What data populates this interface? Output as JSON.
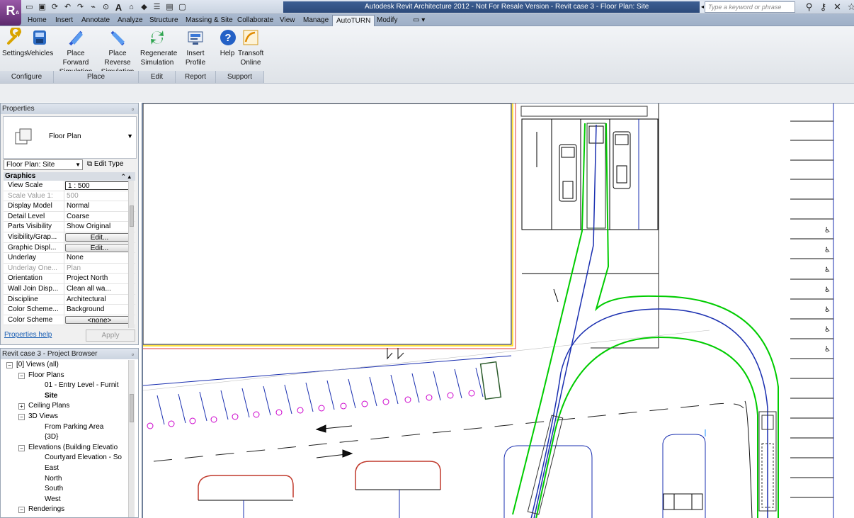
{
  "titlebar": {
    "app_letter": "R",
    "app_sub": "A",
    "title": "Autodesk Revit Architecture 2012 - Not For Resale Version -     Revit case 3 - Floor Plan: Site",
    "search_placeholder": "Type a keyword or phrase",
    "qat_icons": [
      "open-icon",
      "save-icon",
      "sync-icon",
      "undo-icon",
      "redo-icon",
      "measure-icon",
      "text-icon",
      "3d-view-icon",
      "section-icon",
      "thin-lines-icon",
      "close-windows-icon"
    ],
    "right_icons": [
      "binoculars-icon",
      "key-icon",
      "close-icon",
      "star-icon"
    ]
  },
  "tabs": [
    "Home",
    "Insert",
    "Annotate",
    "Analyze",
    "Structure",
    "Massing & Site",
    "Collaborate",
    "View",
    "Manage",
    "AutoTURN",
    "Modify"
  ],
  "active_tab": "AutoTURN",
  "ribbon": {
    "buttons": [
      {
        "label1": "Settings",
        "label2": "",
        "icon": "wrench-icon"
      },
      {
        "label1": "Vehicles",
        "label2": "",
        "icon": "vehicles-icon"
      },
      {
        "label1": "Place Forward",
        "label2": "Simulation",
        "icon": "place-forward-icon"
      },
      {
        "label1": "Place Reverse",
        "label2": "Simulation",
        "icon": "place-reverse-icon"
      },
      {
        "label1": "Regenerate",
        "label2": "Simulation",
        "icon": "regenerate-icon"
      },
      {
        "label1": "Insert Profile",
        "label2": "",
        "icon": "insert-profile-icon"
      },
      {
        "label1": "Help",
        "label2": "",
        "icon": "help-icon"
      },
      {
        "label1": "Transoft",
        "label2": "Online",
        "icon": "transoft-icon"
      }
    ],
    "panels": [
      "Configure",
      "Place",
      "Edit",
      "Report",
      "Support"
    ]
  },
  "properties": {
    "title": "Properties",
    "type_name": "Floor Plan",
    "instance_selector": "Floor Plan: Site",
    "edit_type": "Edit Type",
    "group": "Graphics",
    "rows": [
      {
        "name": "View Scale",
        "value": "1 : 500",
        "kind": "box"
      },
      {
        "name": "Scale Value   1:",
        "value": "500",
        "kind": "dim"
      },
      {
        "name": "Display Model",
        "value": "Normal",
        "kind": ""
      },
      {
        "name": "Detail Level",
        "value": "Coarse",
        "kind": ""
      },
      {
        "name": "Parts Visibility",
        "value": "Show Original",
        "kind": ""
      },
      {
        "name": "Visibility/Grap...",
        "value": "Edit...",
        "kind": "btn"
      },
      {
        "name": "Graphic Displ...",
        "value": "Edit...",
        "kind": "btn"
      },
      {
        "name": "Underlay",
        "value": "None",
        "kind": ""
      },
      {
        "name": "Underlay One...",
        "value": "Plan",
        "kind": "dim"
      },
      {
        "name": "Orientation",
        "value": "Project North",
        "kind": ""
      },
      {
        "name": "Wall Join Disp...",
        "value": "Clean all wa...",
        "kind": ""
      },
      {
        "name": "Discipline",
        "value": "Architectural",
        "kind": ""
      },
      {
        "name": "Color Scheme...",
        "value": "Background",
        "kind": ""
      },
      {
        "name": "Color Scheme",
        "value": "<none>",
        "kind": "btn"
      }
    ],
    "help_link": "Properties help",
    "apply": "Apply"
  },
  "browser": {
    "title": "Revit case 3 - Project Browser",
    "nodes": [
      {
        "label": "[0]  Views (all)",
        "indent": 0,
        "exp": "-"
      },
      {
        "label": "Floor Plans",
        "indent": 1,
        "exp": "-"
      },
      {
        "label": "01 - Entry Level - Furnit",
        "indent": 2,
        "exp": ""
      },
      {
        "label": "Site",
        "indent": 2,
        "exp": "",
        "bold": true
      },
      {
        "label": "Ceiling Plans",
        "indent": 1,
        "exp": "+"
      },
      {
        "label": "3D Views",
        "indent": 1,
        "exp": "-"
      },
      {
        "label": "From Parking Area",
        "indent": 2,
        "exp": ""
      },
      {
        "label": "{3D}",
        "indent": 2,
        "exp": ""
      },
      {
        "label": "Elevations (Building Elevatio",
        "indent": 1,
        "exp": "-"
      },
      {
        "label": "Courtyard Elevation - So",
        "indent": 2,
        "exp": ""
      },
      {
        "label": "East",
        "indent": 2,
        "exp": ""
      },
      {
        "label": "North",
        "indent": 2,
        "exp": ""
      },
      {
        "label": "South",
        "indent": 2,
        "exp": ""
      },
      {
        "label": "West",
        "indent": 2,
        "exp": ""
      },
      {
        "label": "Renderings",
        "indent": 1,
        "exp": "-"
      }
    ]
  },
  "colors": {
    "title_bar": "#2c4a7a",
    "swept_path": "#00cc00",
    "vehicle_path": "#1a2fb0",
    "parking_marker": "#cc00cc",
    "property_line": "#ffd800"
  }
}
